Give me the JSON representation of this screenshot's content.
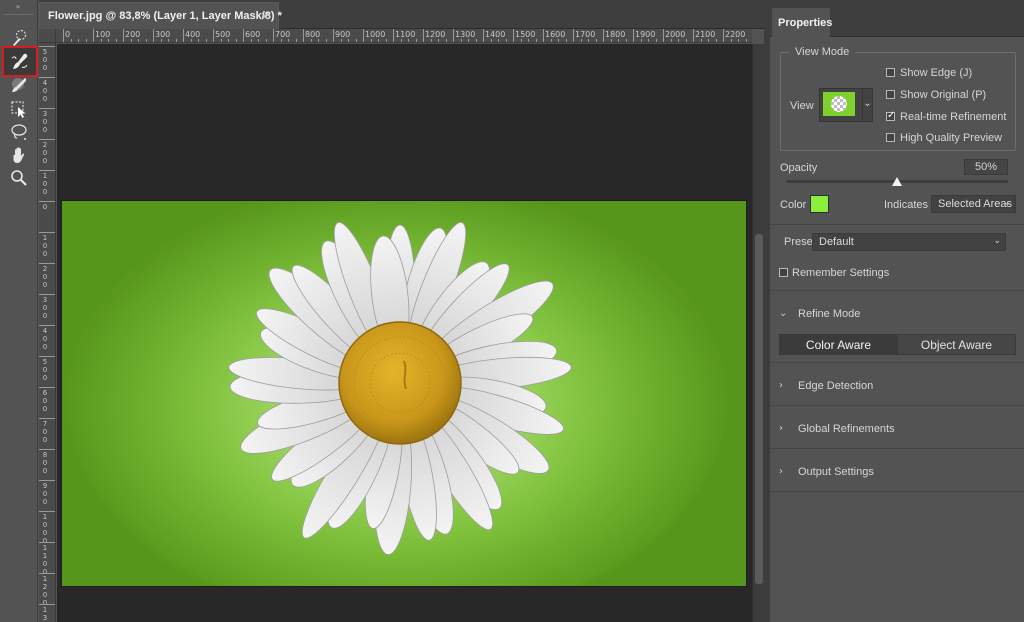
{
  "toolbar": {
    "grip": "»",
    "tools": [
      {
        "name": "quick-selection-brush-icon",
        "active": false
      },
      {
        "name": "refine-edge-brush-icon",
        "active": true
      },
      {
        "name": "brush-icon",
        "active": false
      },
      {
        "name": "object-selection-icon",
        "active": false
      },
      {
        "name": "lasso-icon",
        "active": false
      },
      {
        "name": "hand-icon",
        "active": false
      },
      {
        "name": "zoom-icon",
        "active": false
      }
    ]
  },
  "document": {
    "tab_title": "Flower.jpg @ 83,8% (Layer 1, Layer Mask/8) *",
    "close_glyph": "×",
    "ruler_top_labels": [
      "0",
      "100",
      "200",
      "300",
      "400",
      "500",
      "600",
      "700",
      "800",
      "900",
      "1000",
      "1100",
      "1200",
      "1300",
      "1400",
      "1500",
      "1600",
      "1700",
      "1800",
      "1900",
      "2000",
      "2100",
      "2200"
    ],
    "ruler_left_labels": [
      "500",
      "400",
      "300",
      "200",
      "100",
      "0",
      "100",
      "200",
      "300",
      "400",
      "500",
      "600",
      "700",
      "800",
      "900",
      "1000",
      "1100",
      "1200",
      "1300"
    ],
    "background_color": "#77bf2f"
  },
  "properties": {
    "tab": "Properties",
    "view_mode": {
      "legend": "View Mode",
      "view_label": "View",
      "chevron": "⌄",
      "options": [
        {
          "label": "Show Edge (J)",
          "checked": false
        },
        {
          "label": "Show Original (P)",
          "checked": false
        },
        {
          "label": "Real-time Refinement",
          "checked": true
        },
        {
          "label": "High Quality Preview",
          "checked": false
        }
      ]
    },
    "opacity": {
      "label": "Opacity",
      "value": "50%",
      "level": 0.5
    },
    "color": {
      "label": "Color",
      "swatch": "#88f03a"
    },
    "indicates": {
      "label": "Indicates",
      "value": "Selected Areas",
      "chevron": "⌄"
    },
    "preset": {
      "label": "Preset",
      "value": "Default",
      "chevron": "⌄"
    },
    "remember_settings": {
      "label": "Remember Settings",
      "checked": false
    },
    "refine_mode": {
      "label": "Refine Mode",
      "arrow": "⌄",
      "options": [
        "Color Aware",
        "Object Aware"
      ],
      "selected": "Color Aware"
    },
    "collapsed_sections": [
      {
        "label": "Edge Detection",
        "arrow": "›"
      },
      {
        "label": "Global Refinements",
        "arrow": "›"
      },
      {
        "label": "Output Settings",
        "arrow": "›"
      }
    ]
  }
}
